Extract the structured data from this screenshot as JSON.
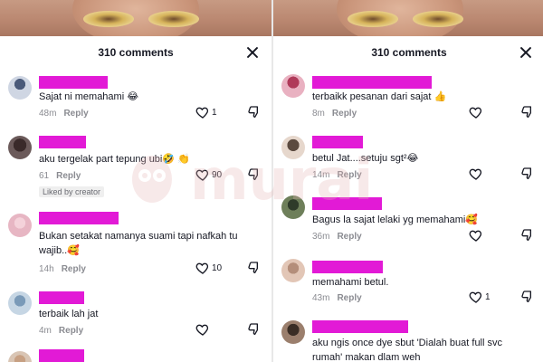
{
  "panels": [
    {
      "header": {
        "title": "310 comments"
      },
      "comments": [
        {
          "text": "Sajat ni memahami 😂",
          "time": "48m",
          "reply": "Reply",
          "likes": "1"
        },
        {
          "text": "aku tergelak part tepung ubi🤣 👏",
          "time": "61",
          "reply": "Reply",
          "likes": "90",
          "badge": "Liked by creator"
        },
        {
          "text": "Bukan setakat namanya suami tapi nafkah tu",
          "text2": "wajib..🥰",
          "time": "14h",
          "reply": "Reply",
          "likes": "10"
        },
        {
          "text": "terbaik lah jat",
          "time": "4m",
          "reply": "Reply",
          "likes": ""
        }
      ]
    },
    {
      "header": {
        "title": "310 comments"
      },
      "comments": [
        {
          "text": "terbaikk pesanan dari sajat 👍",
          "time": "8m",
          "reply": "Reply",
          "likes": ""
        },
        {
          "text": "betul Jat....setuju sgt²😂",
          "time": "14m",
          "reply": "Reply",
          "likes": ""
        },
        {
          "text": "Bagus la sajat lelaki yg memahami🥰",
          "time": "36m",
          "reply": "Reply",
          "likes": ""
        },
        {
          "text": "memahami betul.",
          "time": "43m",
          "reply": "Reply",
          "likes": "1"
        },
        {
          "text": "aku ngis once dye sbut 'Dialah buat full svc",
          "text2": "rumah' makan dlam weh",
          "time": "",
          "reply": "",
          "likes": ""
        }
      ]
    }
  ],
  "watermark": {
    "text": "murai"
  },
  "colors": {
    "redaction": "#e21ad6",
    "watermark": "#e6b3b3"
  },
  "icons": {
    "like": "heart-outline-icon",
    "dislike": "thumbs-down-icon",
    "close": "close-icon"
  }
}
